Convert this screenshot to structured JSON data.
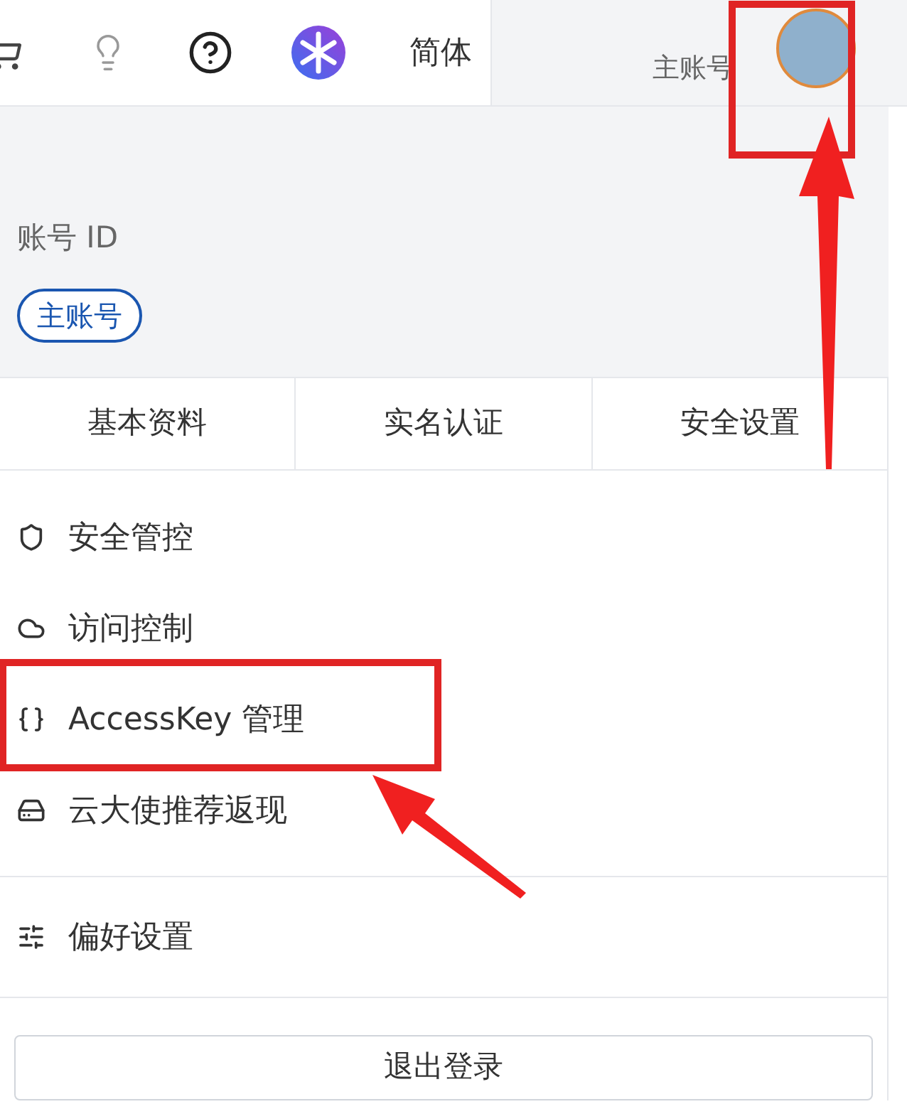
{
  "top_bar": {
    "language": "简体",
    "account_type": "主账号"
  },
  "account": {
    "id_label": "账号 ID",
    "badge": "主账号"
  },
  "tabs": [
    {
      "label": "基本资料"
    },
    {
      "label": "实名认证"
    },
    {
      "label": "安全设置"
    }
  ],
  "menu_groups": [
    [
      {
        "label": "安全管控"
      },
      {
        "label": "访问控制"
      },
      {
        "label": "AccessKey 管理"
      },
      {
        "label": "云大使推荐返现"
      }
    ],
    [
      {
        "label": "偏好设置"
      }
    ]
  ],
  "logout": "退出登录"
}
